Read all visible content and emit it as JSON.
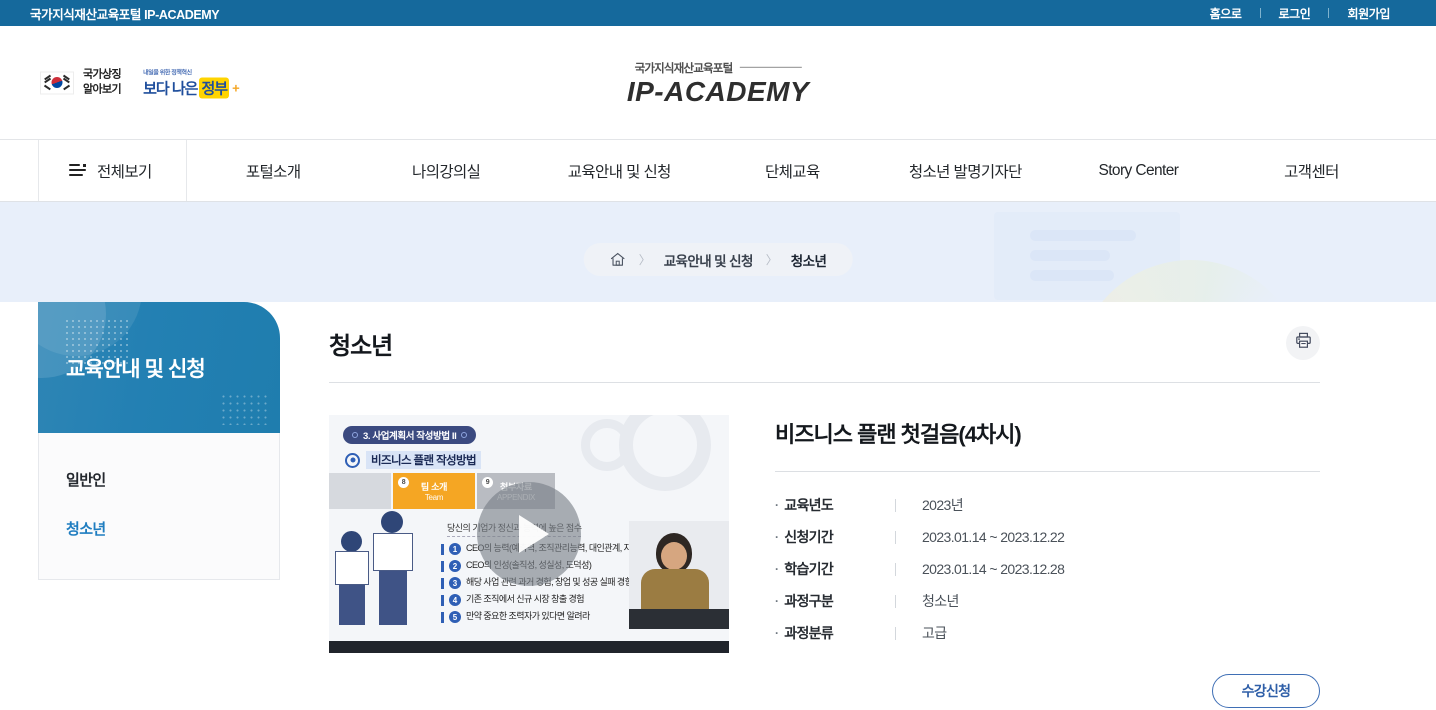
{
  "utility": {
    "site_title": "국가지식재산교육포털 IP-ACADEMY",
    "links": [
      {
        "label": "홈으로"
      },
      {
        "label": "로그인"
      },
      {
        "label": "회원가입"
      }
    ]
  },
  "masthead": {
    "flag_badge_line1": "국가상징",
    "flag_badge_line2": "알아보기",
    "flag_icon": "korean-flag-icon",
    "gov_tagline": "내일을 위한 정책혁신",
    "gov_word1": "보다 나은",
    "gov_word2": "정부",
    "gov_plus": "+",
    "brand_kor": "국가지식재산교육포털",
    "brand_eng": "IP-ACADEMY"
  },
  "nav": {
    "all_menu": {
      "label": "전체보기",
      "icon": "hamburger-icon"
    },
    "items": [
      {
        "label": "포털소개"
      },
      {
        "label": "나의강의실"
      },
      {
        "label": "교육안내 및 신청"
      },
      {
        "label": "단체교육"
      },
      {
        "label": "청소년 발명기자단"
      },
      {
        "label": "Story Center"
      },
      {
        "label": "고객센터"
      }
    ]
  },
  "breadcrumb": {
    "home_icon": "home-icon",
    "separator": "〉",
    "items": [
      {
        "label": "교육안내 및 신청"
      },
      {
        "label": "청소년"
      }
    ]
  },
  "sidebar": {
    "heading": "교육안내 및 신청",
    "items": [
      {
        "label": "일반인",
        "active": false
      },
      {
        "label": "청소년",
        "active": true
      }
    ]
  },
  "page": {
    "title": "청소년",
    "print_icon": "printer-icon"
  },
  "video": {
    "slide_badge": "3. 사업계획서 작성방법 II",
    "slide_subtitle": "비즈니스 플랜 작성방법",
    "tabs": [
      {
        "num": "",
        "line1": "",
        "line2": ""
      },
      {
        "num": "8",
        "line1": "팀 소개",
        "line2": "Team"
      },
      {
        "num": "9",
        "line1": "첨부자료",
        "line2": "APPENDIX"
      }
    ],
    "quote": "당신의 기업가 정신과 능력에 높은 점수",
    "bullets": [
      {
        "num": "1",
        "text": "CEO의 능력(예측력, 조직관리능력, 대인관계, 자금 적기 조달능력)"
      },
      {
        "num": "2",
        "text": "CEO의 인성(솔직성, 성실성, 도덕성)"
      },
      {
        "num": "3",
        "text": "해당 사업 관련 과거 경험, 창업 및 성공 실패 경험"
      },
      {
        "num": "4",
        "text": "기존 조직에서 신규 시장 창출 경험"
      },
      {
        "num": "5",
        "text": "만약 중요한 조력자가 있다면 알려라"
      }
    ],
    "play_icon": "play-button-icon"
  },
  "course": {
    "title": "비즈니스 플랜 첫걸음(4차시)",
    "details": [
      {
        "label": "교육년도",
        "value": "2023년"
      },
      {
        "label": "신청기간",
        "value": "2023.01.14 ~ 2023.12.22"
      },
      {
        "label": "학습기간",
        "value": "2023.01.14 ~ 2023.12.28"
      },
      {
        "label": "과정구분",
        "value": "청소년"
      },
      {
        "label": "과정분류",
        "value": "고급"
      }
    ],
    "apply_label": "수강신청"
  },
  "colors": {
    "utility_bar": "#15699c",
    "sidebar_header": "#2380b3",
    "hero_banner": "#e8effa",
    "accent_link": "#1f7dc0",
    "apply_border": "#3f6fb5"
  }
}
